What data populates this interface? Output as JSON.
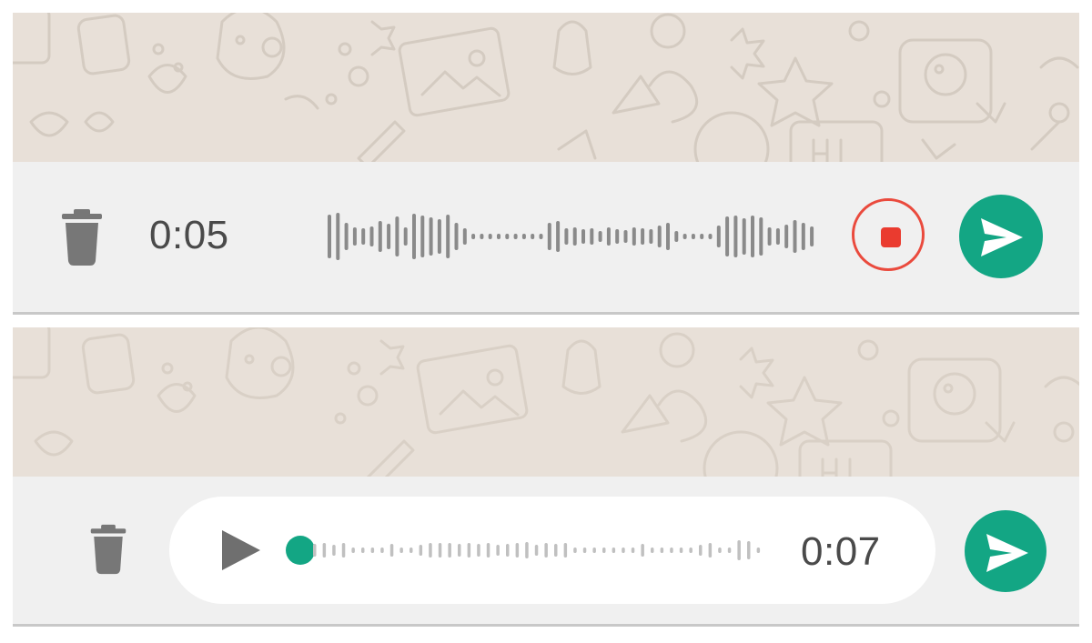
{
  "colors": {
    "wallpaper": "#e8e0d8",
    "doodle": "#d7cec4",
    "composer_bg": "#f0f0f0",
    "accent_green": "#13a684",
    "record_red": "#ea3b2f",
    "icon_gray": "#777777",
    "text_gray": "#4a4a4a",
    "wave_dark": "#8a8a8a",
    "wave_light": "#c0c0c0"
  },
  "recording": {
    "timer": "0:05",
    "icons": {
      "delete": "trash-icon",
      "stop": "stop-record-icon",
      "send": "send-arrow-icon"
    }
  },
  "review": {
    "duration": "0:07",
    "playback_progress": 0,
    "icons": {
      "delete": "trash-icon",
      "play": "play-icon",
      "send": "send-arrow-icon"
    }
  }
}
